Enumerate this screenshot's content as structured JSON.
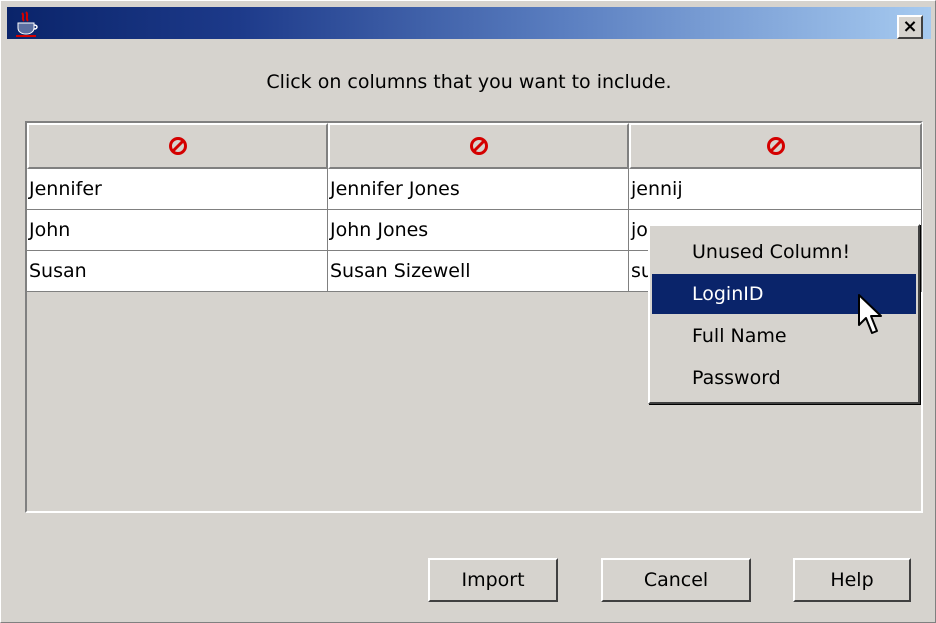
{
  "window": {
    "app_icon": "java-cup-icon",
    "close_label": "×"
  },
  "prompt": "Click on columns that you want to include.",
  "table": {
    "header_icon": "no-entry-icon",
    "rows": [
      [
        "Jennifer",
        "Jennifer Jones",
        "jennij"
      ],
      [
        "John",
        "John Jones",
        "jo"
      ],
      [
        "Susan",
        "Susan Sizewell",
        "su"
      ]
    ]
  },
  "popup_menu": {
    "items": [
      "Unused Column!",
      "LoginID",
      "Full Name",
      "Password"
    ],
    "selected": "LoginID"
  },
  "buttons": {
    "import": "Import",
    "cancel": "Cancel",
    "help": "Help"
  },
  "colors": {
    "selection": "#0a246a",
    "dialog_bg": "#d6d3ce",
    "no_entry_red": "#d40000"
  }
}
